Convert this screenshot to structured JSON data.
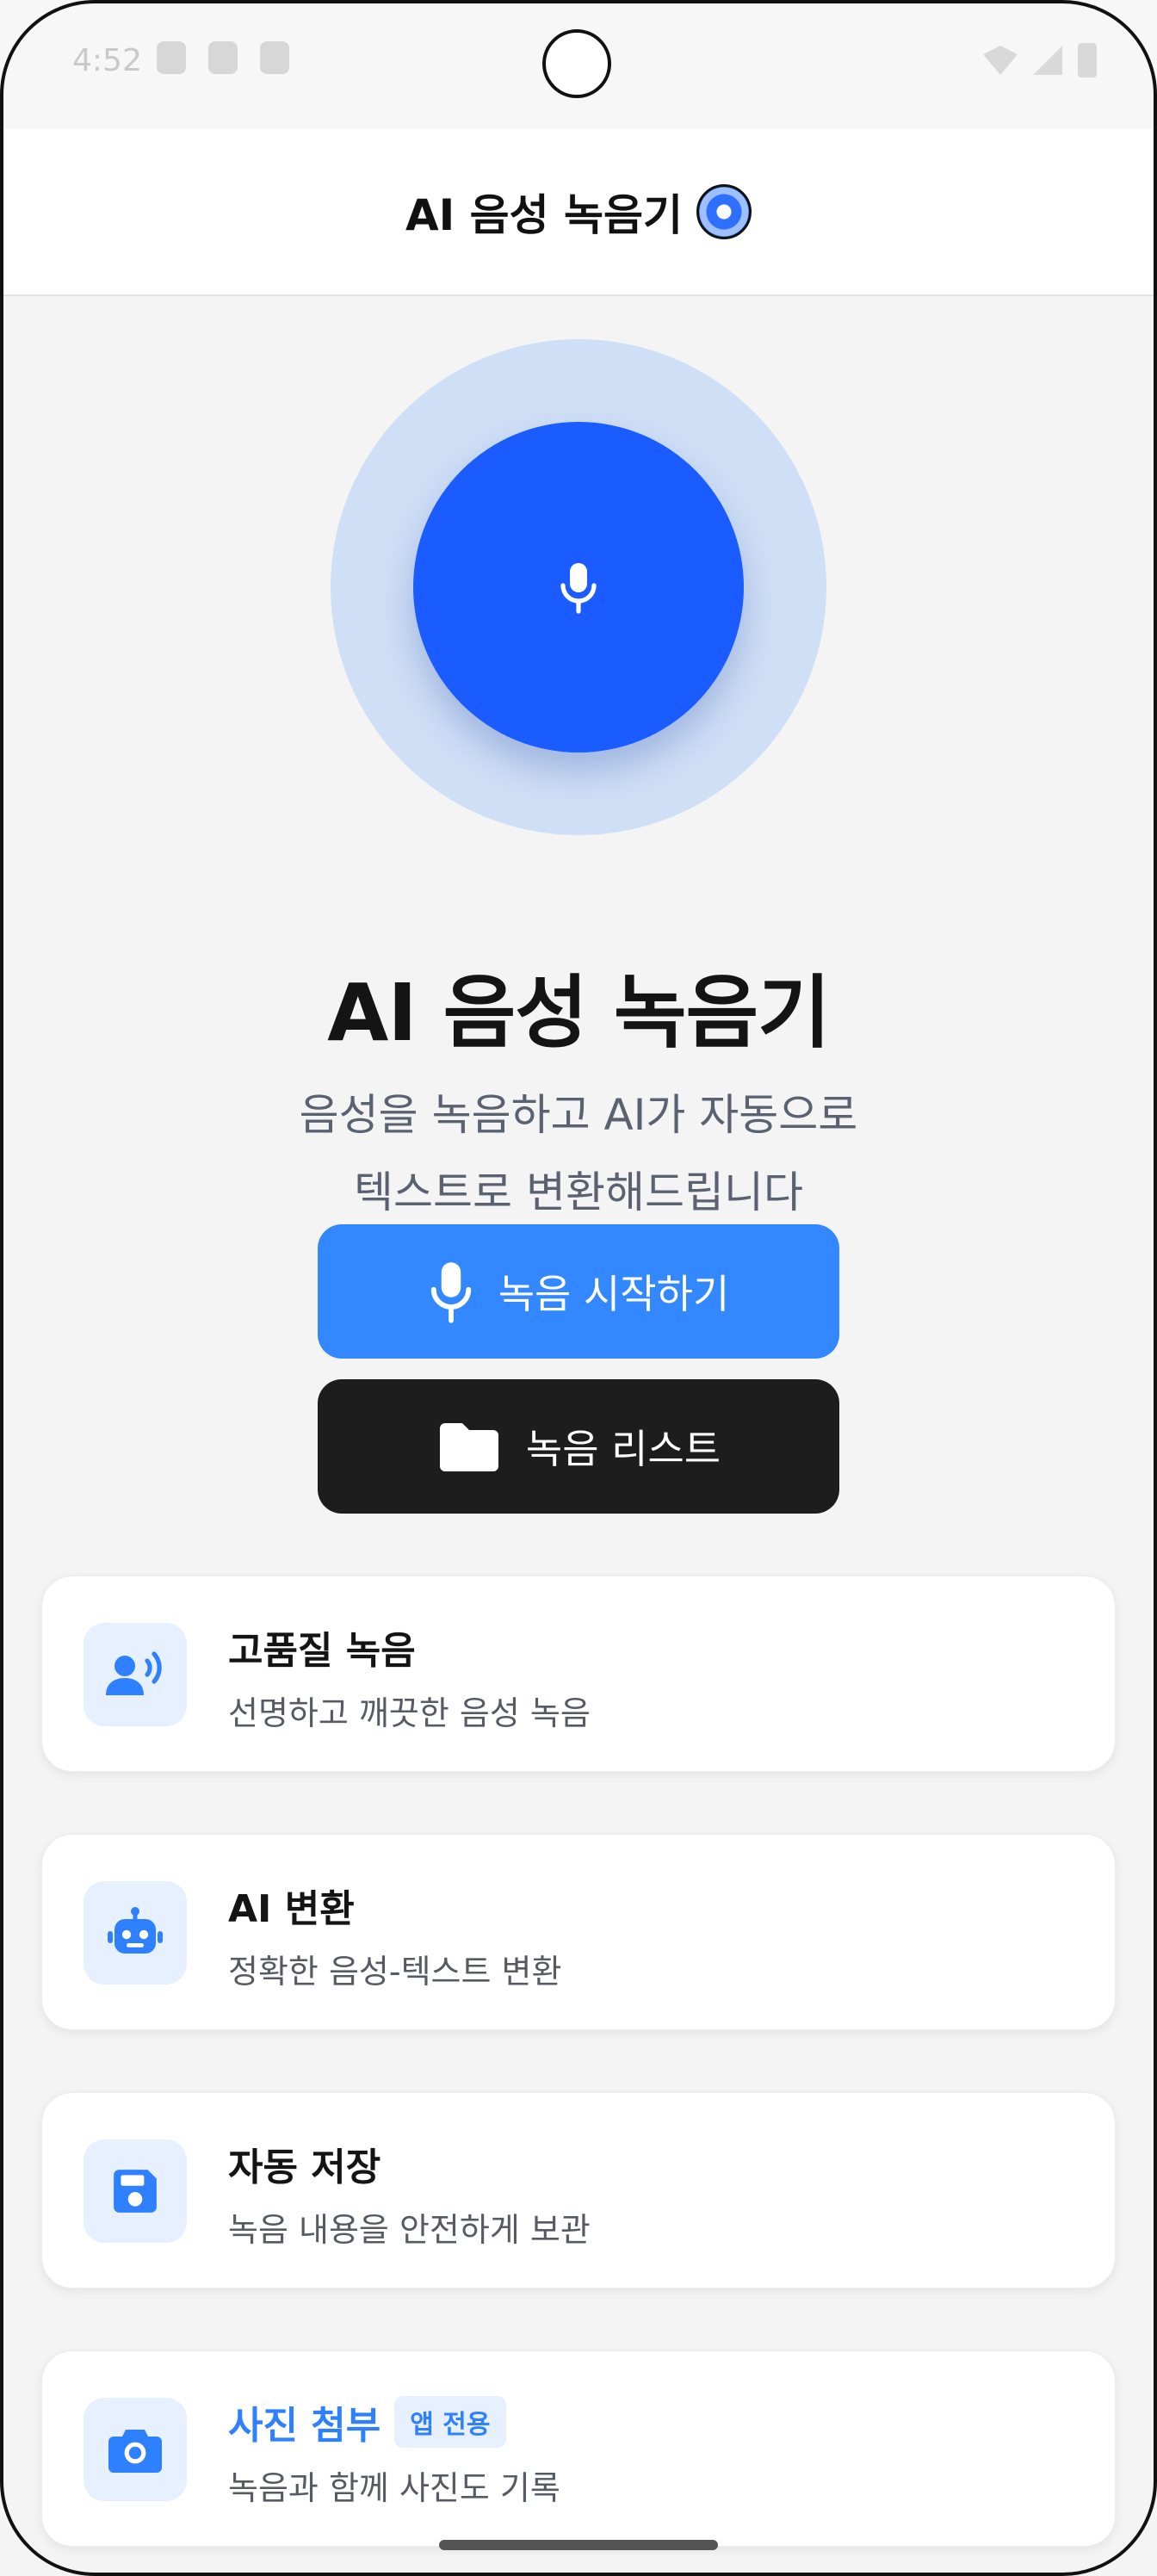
{
  "status_bar": {
    "time": "4:52"
  },
  "header": {
    "title": "AI 음성 녹음기",
    "icon": "disc-icon"
  },
  "hero": {
    "mic_icon": "mic-icon",
    "title": "AI 음성 녹음기",
    "subtitle_lines": [
      "음성을 녹음하고 AI가 자동으로",
      "텍스트로 변환해드립니다"
    ]
  },
  "buttons": {
    "start": {
      "label": "녹음 시작하기",
      "icon": "mic-icon"
    },
    "list": {
      "label": "녹음 리스트",
      "icon": "folder-icon"
    }
  },
  "features": [
    {
      "title": "고품질 녹음",
      "description": "선명하고 깨끗한 음성 녹음",
      "icon": "voice-person-icon"
    },
    {
      "title": "AI 변환",
      "description": "정확한 음성-텍스트 변환",
      "icon": "robot-icon"
    },
    {
      "title": "자동 저장",
      "description": "녹음 내용을 안전하게 보관",
      "icon": "save-icon"
    },
    {
      "title": "사진 첨부",
      "badge": "앱 전용",
      "description": "녹음과 함께 사진도 기록",
      "icon": "camera-icon"
    }
  ],
  "colors": {
    "primary": "#1a5cff",
    "accent": "#3388ff",
    "dark_button": "#1d1d1d",
    "halo": "#cfdff6",
    "icon_bg": "#e6f0ff"
  }
}
